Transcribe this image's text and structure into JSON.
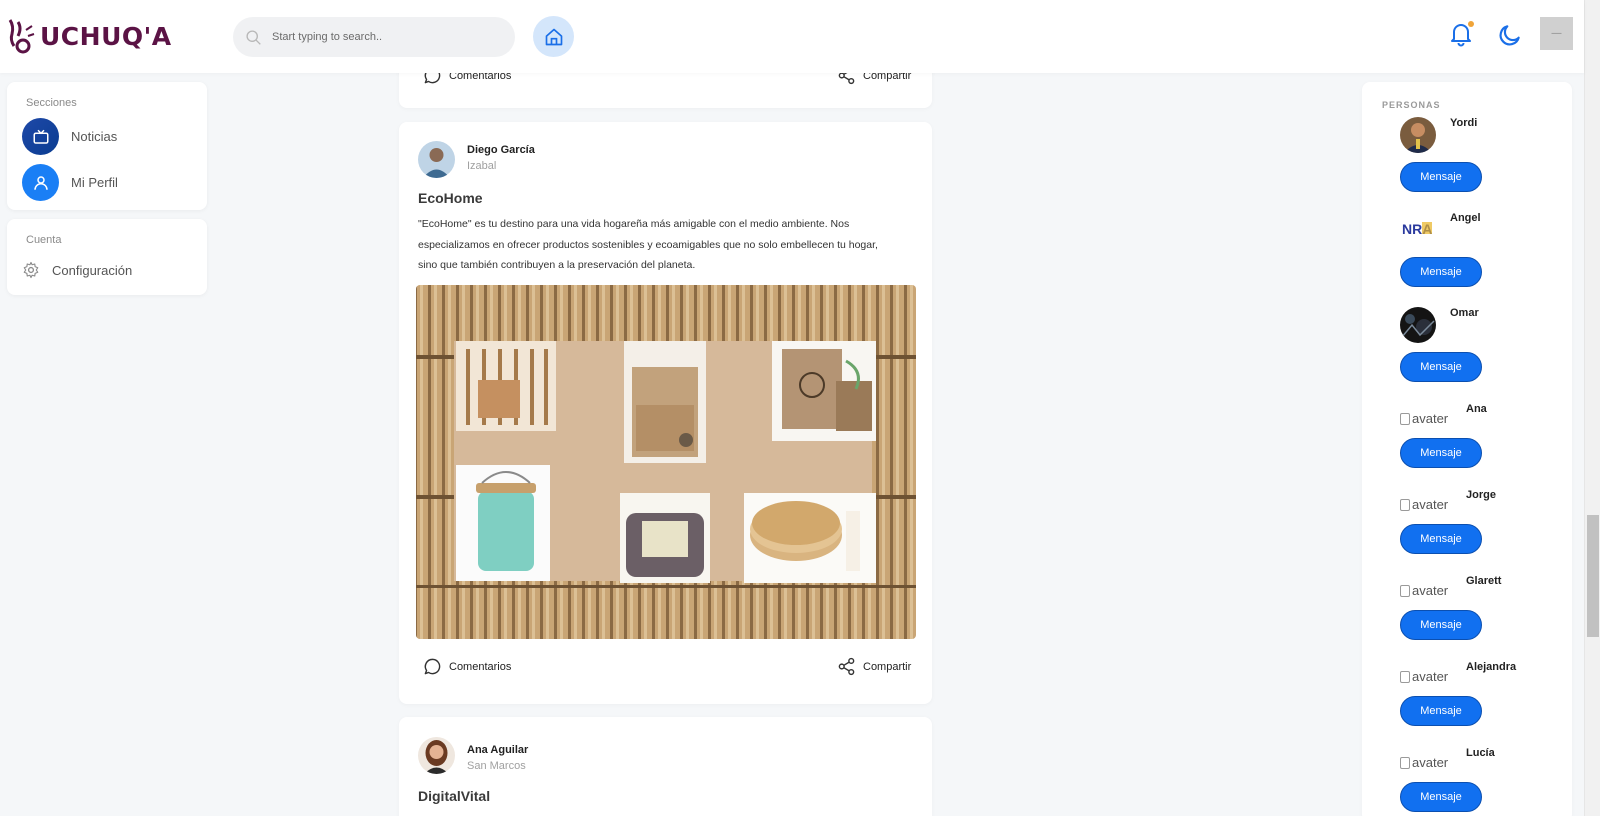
{
  "header": {
    "logo_text": "UCHUQ'A",
    "search_placeholder": "Start typing to search..",
    "avatar_label": "—"
  },
  "sidebar": {
    "secciones_title": "Secciones",
    "items": [
      {
        "label": "Noticias",
        "icon": "tv-icon"
      },
      {
        "label": "Mi Perfil",
        "icon": "user-icon"
      }
    ],
    "cuenta_title": "Cuenta",
    "config_label": "Configuración"
  },
  "feed": {
    "prev_post": {
      "comments_label": "Comentarios",
      "share_label": "Compartir"
    },
    "post": {
      "author": "Diego García",
      "location": "Izabal",
      "title": "EcoHome",
      "description": "\"EcoHome\" es tu destino para una vida hogareña más amigable con el medio ambiente. Nos especializamos en ofrecer productos sostenibles y ecoamigables que no solo embellecen tu hogar, sino que también contribuyen a la preservación del planeta.",
      "comments_label": "Comentarios",
      "share_label": "Compartir"
    },
    "next_post": {
      "author": "Ana Aguilar",
      "location": "San Marcos",
      "title": "DigitalVital"
    }
  },
  "personas": {
    "title": "PERSONAS",
    "button_label": "Mensaje",
    "broken_alt": "avater",
    "people": [
      {
        "name": "Yordi",
        "avatar": "photo"
      },
      {
        "name": "Angel",
        "avatar": "logo"
      },
      {
        "name": "Omar",
        "avatar": "photo-dark"
      },
      {
        "name": "Ana",
        "avatar": "broken"
      },
      {
        "name": "Jorge",
        "avatar": "broken"
      },
      {
        "name": "Glarett",
        "avatar": "broken"
      },
      {
        "name": "Alejandra",
        "avatar": "broken"
      },
      {
        "name": "Lucía",
        "avatar": "broken"
      }
    ]
  },
  "colors": {
    "brand": "#5b1345",
    "primary": "#1170f0",
    "notification_dot": "#f0a438"
  }
}
